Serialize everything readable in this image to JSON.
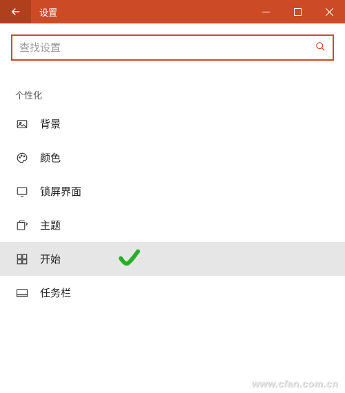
{
  "titlebar": {
    "title": "设置"
  },
  "search": {
    "placeholder": "查找设置"
  },
  "section": {
    "header": "个性化"
  },
  "nav": {
    "items": [
      {
        "label": "背景",
        "icon": "image-icon"
      },
      {
        "label": "颜色",
        "icon": "palette-icon"
      },
      {
        "label": "锁屏界面",
        "icon": "lock-screen-icon"
      },
      {
        "label": "主题",
        "icon": "theme-icon"
      },
      {
        "label": "开始",
        "icon": "start-icon"
      },
      {
        "label": "任务栏",
        "icon": "taskbar-icon"
      }
    ],
    "selected_index": 4
  },
  "watermark": "www.cfan.com.cn",
  "colors": {
    "accent": "#cc4b26",
    "accent_dark": "#b03f1e",
    "check": "#2cb52c"
  }
}
